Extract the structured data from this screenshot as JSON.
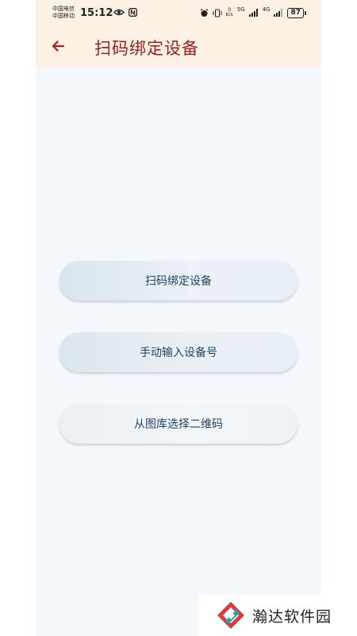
{
  "status_bar": {
    "carrier_1": "中国电信",
    "carrier_2": "中国移动",
    "time": "15:12",
    "net_speed_value": "0",
    "net_speed_unit": "K/s",
    "signal_1_label": "5G",
    "signal_2_label": "4G",
    "battery": "87",
    "icons": [
      "eye-icon",
      "nfc-icon",
      "alarm-icon",
      "vibrate-icon",
      "signal-icon",
      "battery-icon"
    ]
  },
  "app_bar": {
    "title": "扫码绑定设备",
    "back_icon": "back-arrow-icon",
    "accent_color": "#9c1d1d",
    "background_color": "#fdf1e3"
  },
  "actions": {
    "scan_label": "扫码绑定设备",
    "manual_label": "手动输入设备号",
    "gallery_label": "从图库选择二维码"
  },
  "watermark": {
    "text": "瀚达软件园"
  }
}
